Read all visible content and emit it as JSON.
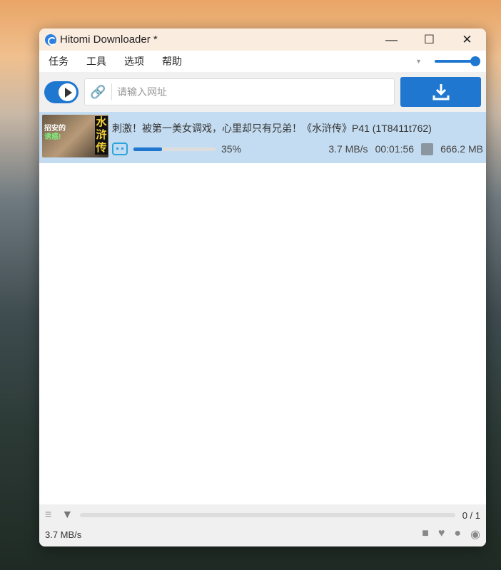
{
  "window": {
    "title": "Hitomi Downloader *",
    "minimize": "—",
    "maximize": "☐",
    "close": "✕"
  },
  "menu": [
    "任务",
    "工具",
    "选项",
    "帮助"
  ],
  "toolbar": {
    "url_placeholder": "请输入网址",
    "link_icon": "🔗",
    "download_icon": "download-icon"
  },
  "accent": "#1f77d0",
  "tasks": [
    {
      "title": "刺激！被第一美女调戏，心里却只有兄弟！《水浒传》P41 (1T8411t762)",
      "thumb_text_1": "招安的",
      "thumb_text_2": "诱惑!",
      "thumb_text_3": "水浒传",
      "source": "bilibili",
      "progress_percent": 35,
      "progress": "35%",
      "speed": "3.7 MB/s",
      "eta": "00:01:56",
      "size": "666.2 MB"
    }
  ],
  "footer": {
    "count": "0 / 1",
    "speed": "3.7 MB/s"
  }
}
